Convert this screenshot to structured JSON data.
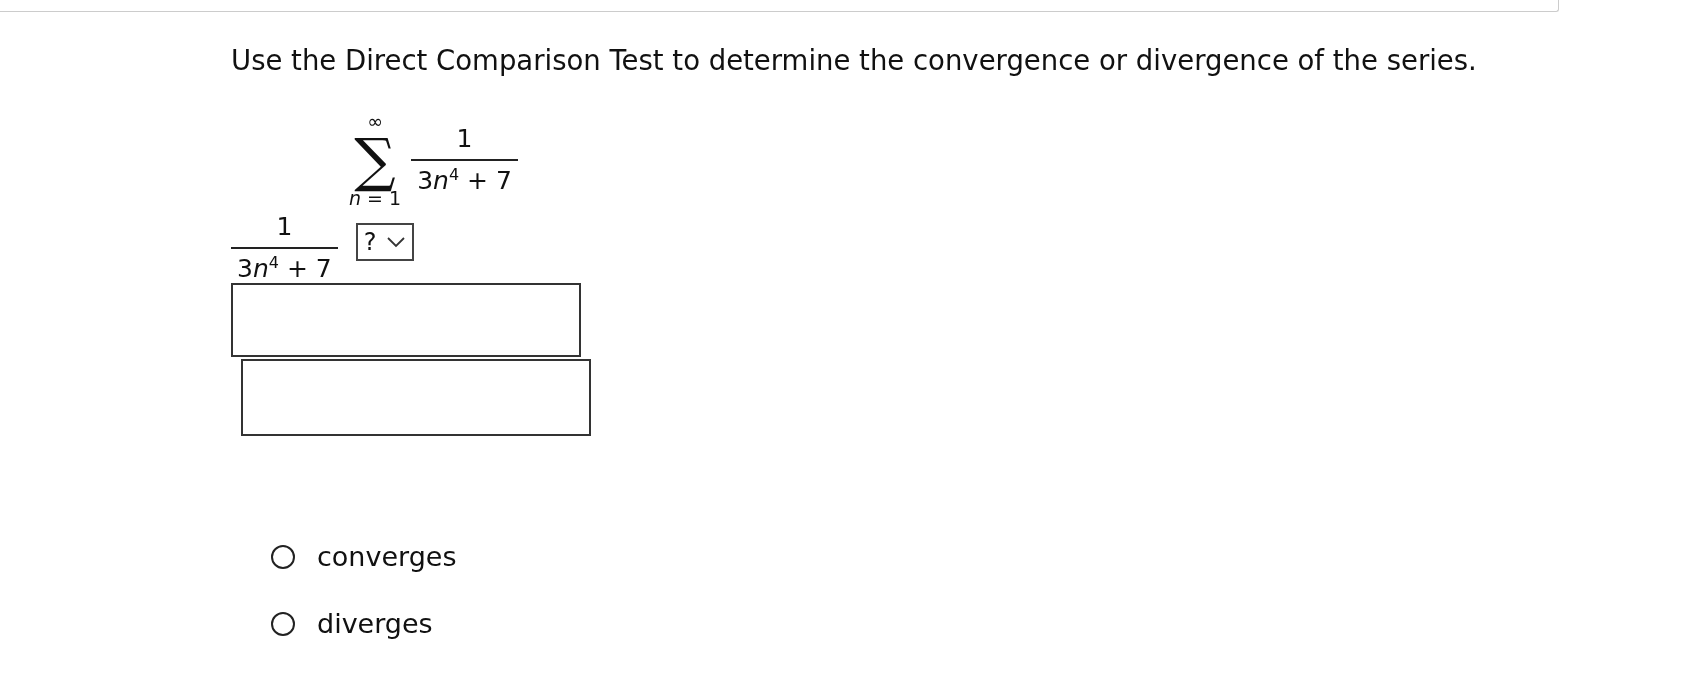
{
  "question": "Use the Direct Comparison Test to determine the convergence or divergence of the series.",
  "series": {
    "symbol": "∑",
    "upper": "∞",
    "lower": "*n* = 1",
    "numerator": "1",
    "denominator": {
      "coefficient": "3",
      "variable": "n",
      "power": "4",
      "tail": "+ 7"
    }
  },
  "comparison": {
    "numerator": "1",
    "denominator": {
      "coefficient": "3",
      "variable": "n",
      "power": "4",
      "tail": "+ 7"
    },
    "dropdown": {
      "value": "?"
    }
  },
  "answer_fields": [
    {
      "kind": "text"
    },
    {
      "kind": "text"
    }
  ],
  "options": [
    {
      "label": "converges",
      "selected": false
    },
    {
      "label": "diverges",
      "selected": false
    }
  ]
}
